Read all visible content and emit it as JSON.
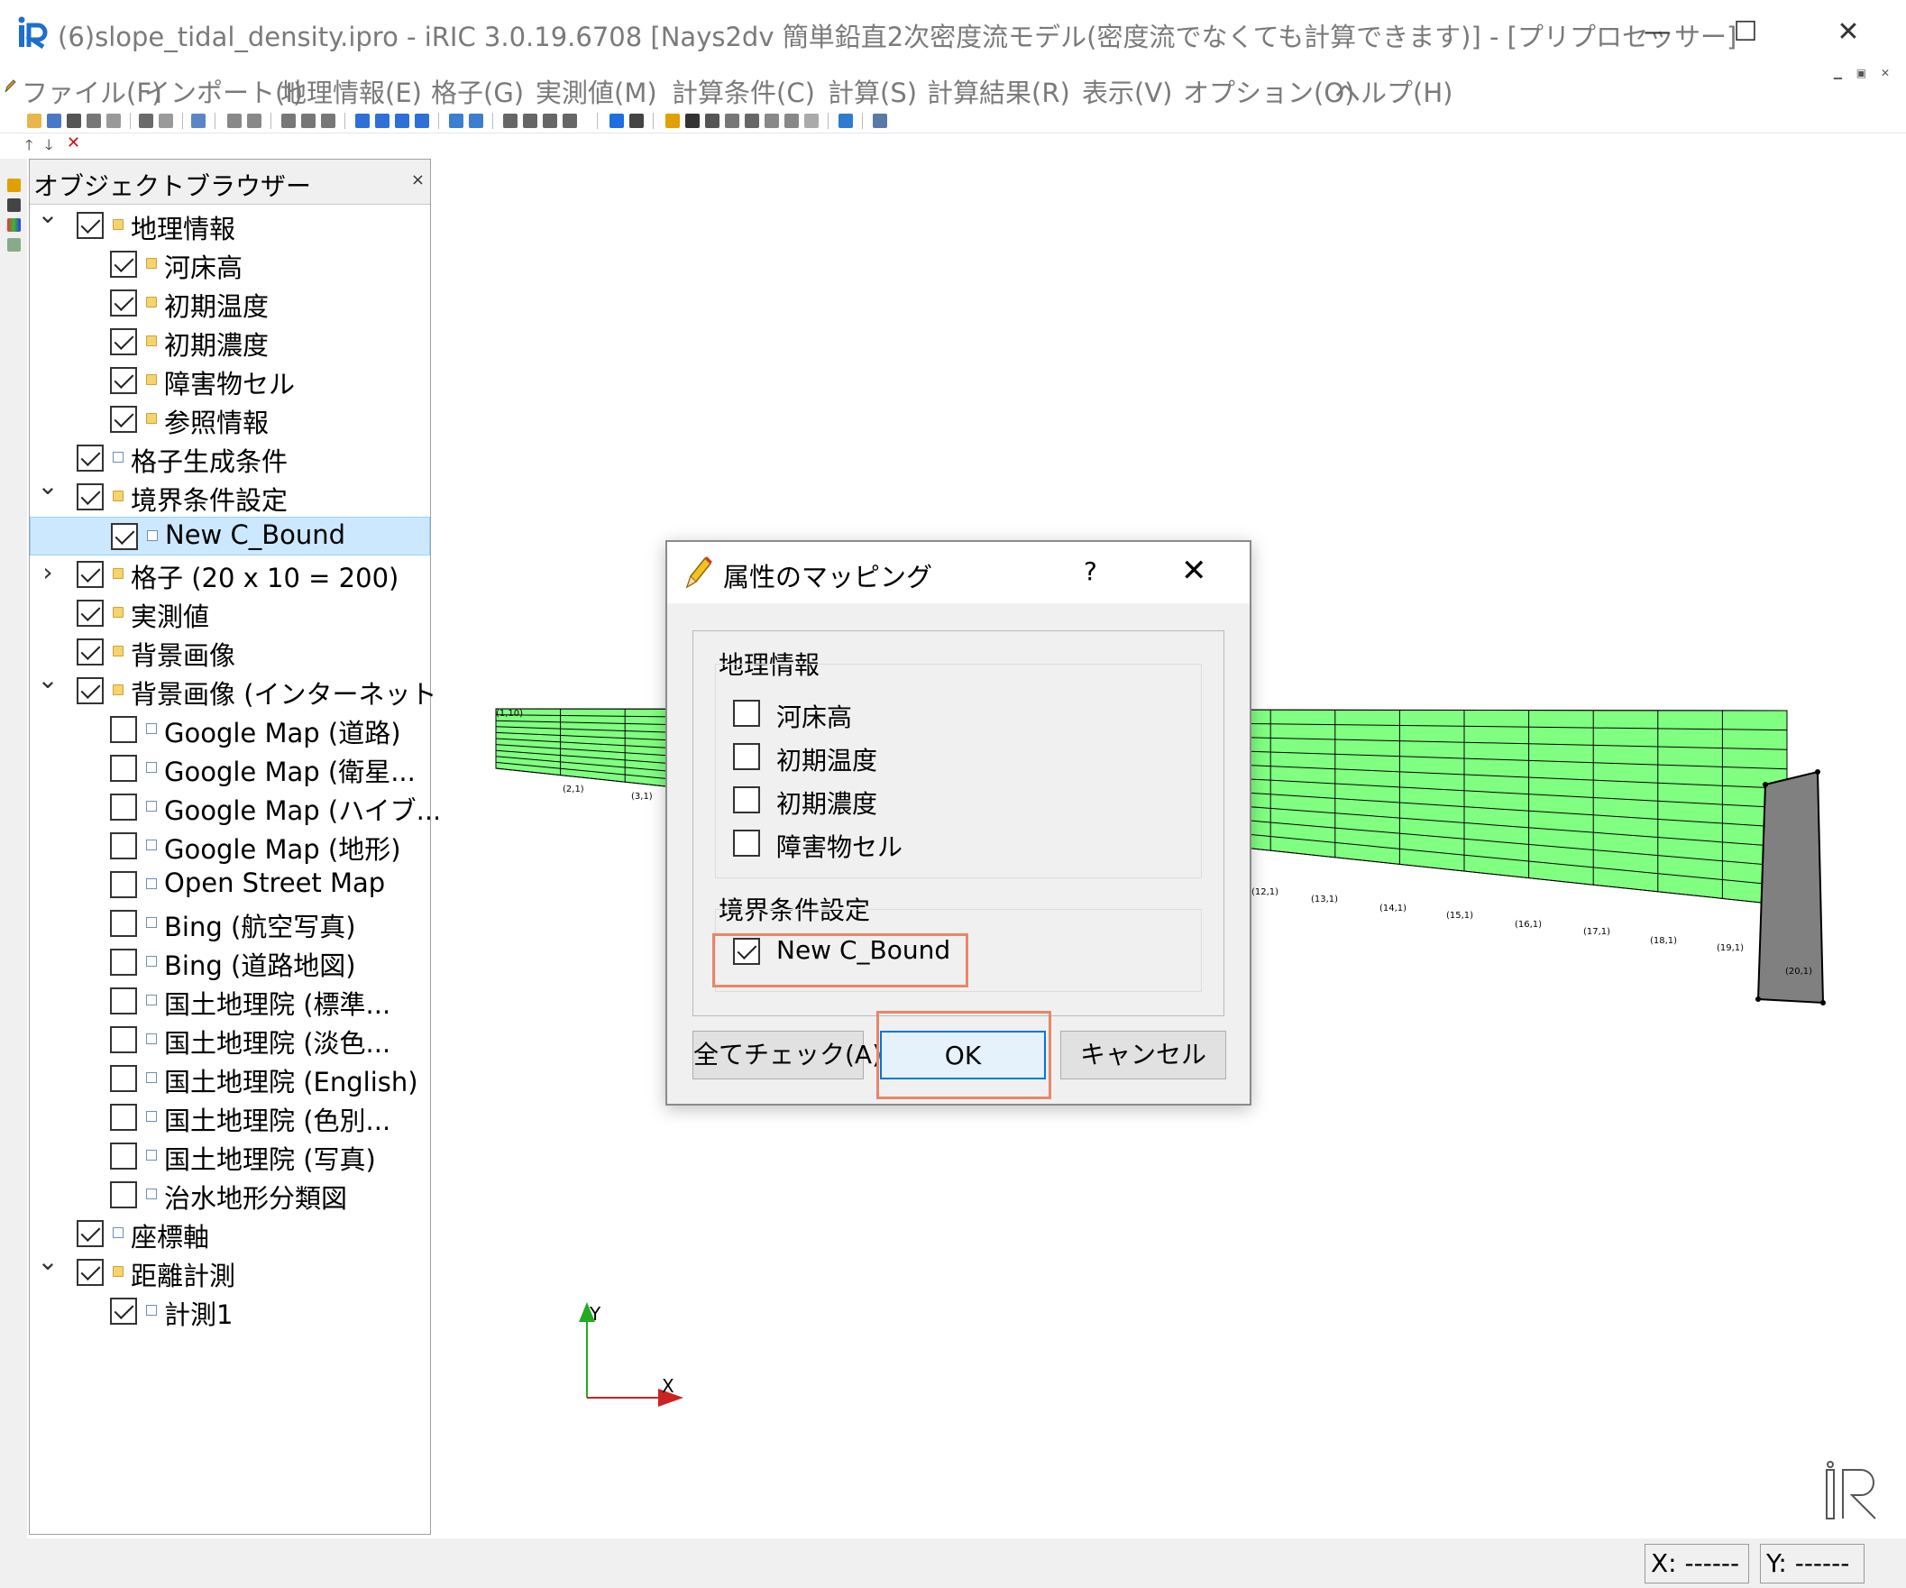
{
  "window": {
    "title": "(6)slope_tidal_density.ipro - iRIC 3.0.19.6708 [Nays2dv 簡単鉛直2次密度流モデル(密度流でなくても計算できます)] - [プリプロセッサー]",
    "minimize": "—",
    "maximize": "☐",
    "close": "✕"
  },
  "menu": [
    "ファイル(F)",
    "インポート(I)",
    "地理情報(E)",
    "格子(G)",
    "実測値(M)",
    "計算条件(C)",
    "計算(S)",
    "計算結果(R)",
    "表示(V)",
    "オプション(O)",
    "ヘルプ(H)"
  ],
  "browser": {
    "title": "オブジェクトブラウザー",
    "close": "×",
    "items": [
      {
        "label": "地理情報",
        "indent": 0,
        "expand": "open",
        "checked": true,
        "icon": "folder-icon"
      },
      {
        "label": "河床高",
        "indent": 1,
        "expand": "",
        "checked": true,
        "icon": "folder-icon"
      },
      {
        "label": "初期温度",
        "indent": 1,
        "expand": "",
        "checked": true,
        "icon": "folder-icon"
      },
      {
        "label": "初期濃度",
        "indent": 1,
        "expand": "",
        "checked": true,
        "icon": "folder-icon"
      },
      {
        "label": "障害物セル",
        "indent": 1,
        "expand": "",
        "checked": true,
        "icon": "folder-icon"
      },
      {
        "label": "参照情報",
        "indent": 1,
        "expand": "",
        "checked": true,
        "icon": "folder-icon"
      },
      {
        "label": "格子生成条件",
        "indent": 0,
        "expand": "",
        "checked": true,
        "icon": "file-icon"
      },
      {
        "label": "境界条件設定",
        "indent": 0,
        "expand": "open",
        "checked": true,
        "icon": "folder-icon"
      },
      {
        "label": "New C_Bound",
        "indent": 1,
        "expand": "",
        "checked": true,
        "icon": "file-icon",
        "selected": true
      },
      {
        "label": "格子 (20 x 10 = 200)",
        "indent": 0,
        "expand": "closed",
        "checked": true,
        "icon": "folder-icon"
      },
      {
        "label": "実測値",
        "indent": 0,
        "expand": "",
        "checked": true,
        "icon": "folder-icon"
      },
      {
        "label": "背景画像",
        "indent": 0,
        "expand": "",
        "checked": true,
        "icon": "folder-icon"
      },
      {
        "label": "背景画像 (インターネット)",
        "indent": 0,
        "expand": "open",
        "checked": true,
        "icon": "folder-icon"
      },
      {
        "label": "Google Map (道路)",
        "indent": 1,
        "expand": "",
        "checked": false,
        "icon": "file-icon"
      },
      {
        "label": "Google Map (衛星...",
        "indent": 1,
        "expand": "",
        "checked": false,
        "icon": "file-icon"
      },
      {
        "label": "Google Map (ハイブ...",
        "indent": 1,
        "expand": "",
        "checked": false,
        "icon": "file-icon"
      },
      {
        "label": "Google Map (地形)",
        "indent": 1,
        "expand": "",
        "checked": false,
        "icon": "file-icon"
      },
      {
        "label": "Open Street Map",
        "indent": 1,
        "expand": "",
        "checked": false,
        "icon": "file-icon"
      },
      {
        "label": "Bing (航空写真)",
        "indent": 1,
        "expand": "",
        "checked": false,
        "icon": "file-icon"
      },
      {
        "label": "Bing (道路地図)",
        "indent": 1,
        "expand": "",
        "checked": false,
        "icon": "file-icon"
      },
      {
        "label": "国土地理院 (標準...",
        "indent": 1,
        "expand": "",
        "checked": false,
        "icon": "file-icon"
      },
      {
        "label": "国土地理院 (淡色...",
        "indent": 1,
        "expand": "",
        "checked": false,
        "icon": "file-icon"
      },
      {
        "label": "国土地理院 (English)",
        "indent": 1,
        "expand": "",
        "checked": false,
        "icon": "file-icon"
      },
      {
        "label": "国土地理院 (色別...",
        "indent": 1,
        "expand": "",
        "checked": false,
        "icon": "file-icon"
      },
      {
        "label": "国土地理院 (写真)",
        "indent": 1,
        "expand": "",
        "checked": false,
        "icon": "file-icon"
      },
      {
        "label": "治水地形分類図",
        "indent": 1,
        "expand": "",
        "checked": false,
        "icon": "file-icon"
      },
      {
        "label": "座標軸",
        "indent": 0,
        "expand": "",
        "checked": true,
        "icon": "file-icon"
      },
      {
        "label": "距離計測",
        "indent": 0,
        "expand": "open",
        "checked": true,
        "icon": "folder-icon"
      },
      {
        "label": "計測1",
        "indent": 1,
        "expand": "",
        "checked": true,
        "icon": "file-icon"
      }
    ]
  },
  "canvas": {
    "grid_labels_left": [
      "(1,10)",
      "(2,1)",
      "(3,1)"
    ],
    "grid_labels_right": [
      "(12,1)",
      "(13,1)",
      "(14,1)",
      "(15,1)",
      "(16,1)",
      "(17,1)",
      "(18,1)",
      "(19,1)",
      "(20,1)"
    ],
    "axis_x": "X",
    "axis_y": "Y",
    "grid_color": "#80ff80",
    "boundary_color": "#808080"
  },
  "dialog": {
    "title": "属性のマッピング",
    "help": "?",
    "close": "✕",
    "group1_title": "地理情報",
    "group1_items": [
      {
        "label": "河床高",
        "checked": false
      },
      {
        "label": "初期温度",
        "checked": false
      },
      {
        "label": "初期濃度",
        "checked": false
      },
      {
        "label": "障害物セル",
        "checked": false
      }
    ],
    "group2_title": "境界条件設定",
    "group2_items": [
      {
        "label": "New C_Bound",
        "checked": true
      }
    ],
    "check_all": "全てチェック(A)",
    "ok": "OK",
    "cancel": "キャンセル"
  },
  "status": {
    "x": "X: ------",
    "y": "Y: ------"
  }
}
